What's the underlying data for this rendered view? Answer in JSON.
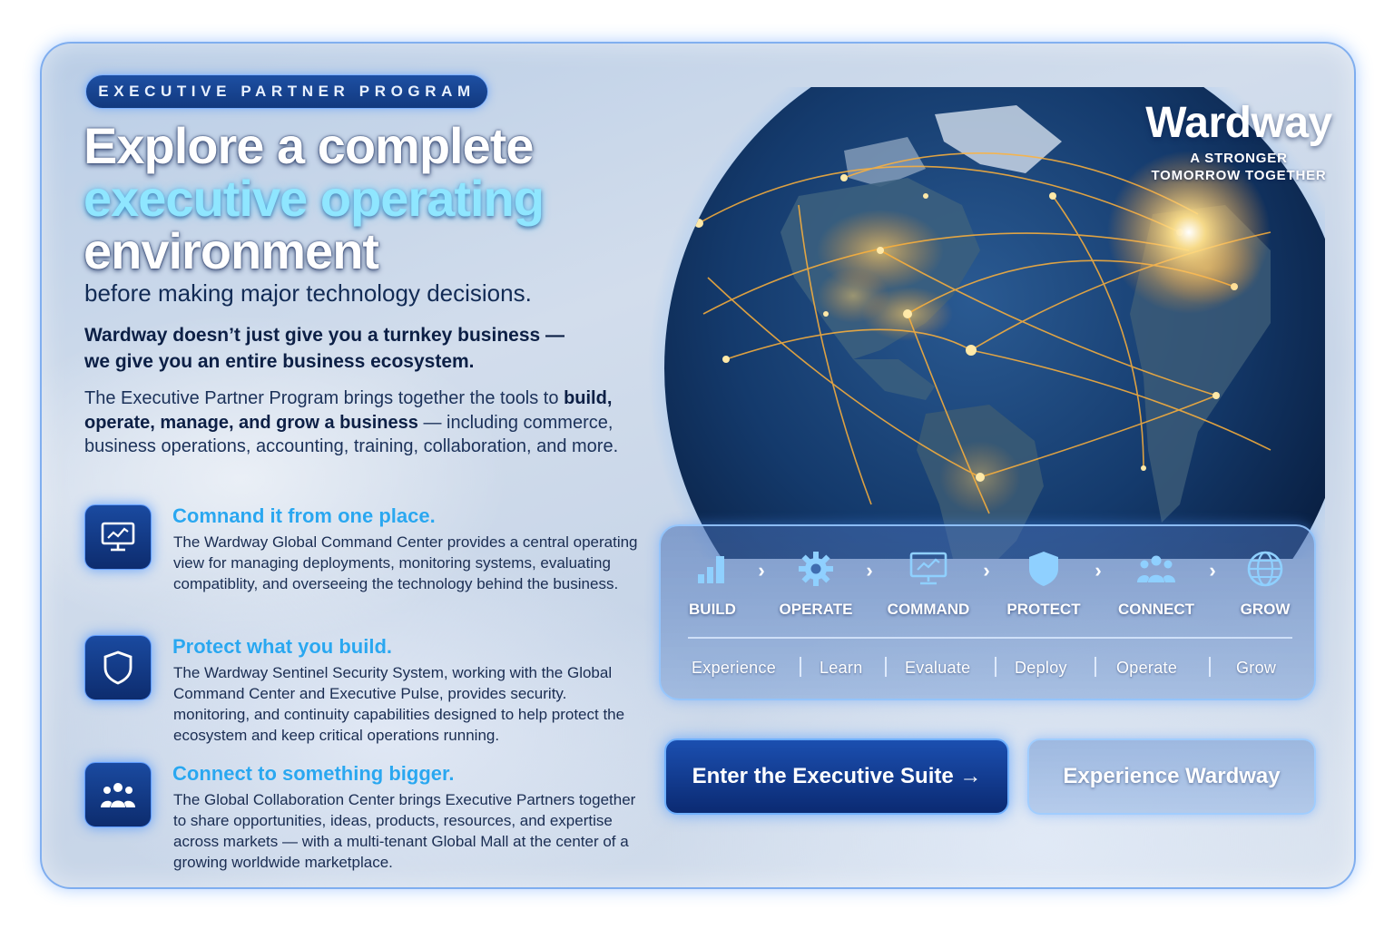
{
  "tag": "EXECUTIVE PARTNER PROGRAM",
  "headline": {
    "line1": "Explore a complete",
    "line2": "executive operating",
    "line3": "environment"
  },
  "subhead": "before making major technology decisions.",
  "lead": {
    "line1": "Wardway doesn’t just give you a turnkey business —",
    "line2": "we give you an entire business ecosystem."
  },
  "body": {
    "part1": "The Executive Partner Program brings together the tools to",
    "bold": "build, operate, manage, and grow a business",
    "part2": " — including commerce, business operations, accounting, training, collaboration, and more."
  },
  "features": [
    {
      "icon": "monitor-chart-icon",
      "title": "Comnand it from one place.",
      "desc": "The Wardway Global Command Center provides a central operating view for managing deployments, monitoring systems, evaluating compatiblity, and overseeing the technology behind the business."
    },
    {
      "icon": "shield-icon",
      "title": "Protect what you build.",
      "desc": "The Wardway Sentinel Security System, working with the Global Command Center and Executive Pulse, provides security. monitoring, and continuity capabilities designed to help protect the ecosystem and keep critical operations running."
    },
    {
      "icon": "people-icon",
      "title": "Connect to something bigger.",
      "desc": "The Global Collaboration Center brings Executive Partners together to share opportunities, ideas, products, resources, and expertise across markets — with a multi-tenant Global Mall at the center of a growing worldwide marketplace."
    }
  ],
  "brand": {
    "name": "Wardway",
    "tagline_line1": "A STRONGER",
    "tagline_line2": "TOMORROW TOGETHER"
  },
  "steps": [
    {
      "label": "BUILD",
      "icon": "bar-chart-icon"
    },
    {
      "label": "OPERATE",
      "icon": "gear-icon"
    },
    {
      "label": "COMMAND",
      "icon": "monitor-icon"
    },
    {
      "label": "PROTECT",
      "icon": "shield-icon"
    },
    {
      "label": "CONNECT",
      "icon": "people-icon"
    },
    {
      "label": "GROW",
      "icon": "globe-icon"
    }
  ],
  "step_arrow": "›",
  "phases": [
    "Experience",
    "Learn",
    "Evaluate",
    "Deploy",
    "Operate",
    "Grow"
  ],
  "buttons": {
    "primary": "Enter the Executive Suite →",
    "secondary": "Experience Wardway"
  },
  "colors": {
    "accent_cyan": "#8fe6ff",
    "feature_title": "#2aa7f0",
    "button_navy": "#0b2a72",
    "city_lights": "#ffb23a"
  }
}
